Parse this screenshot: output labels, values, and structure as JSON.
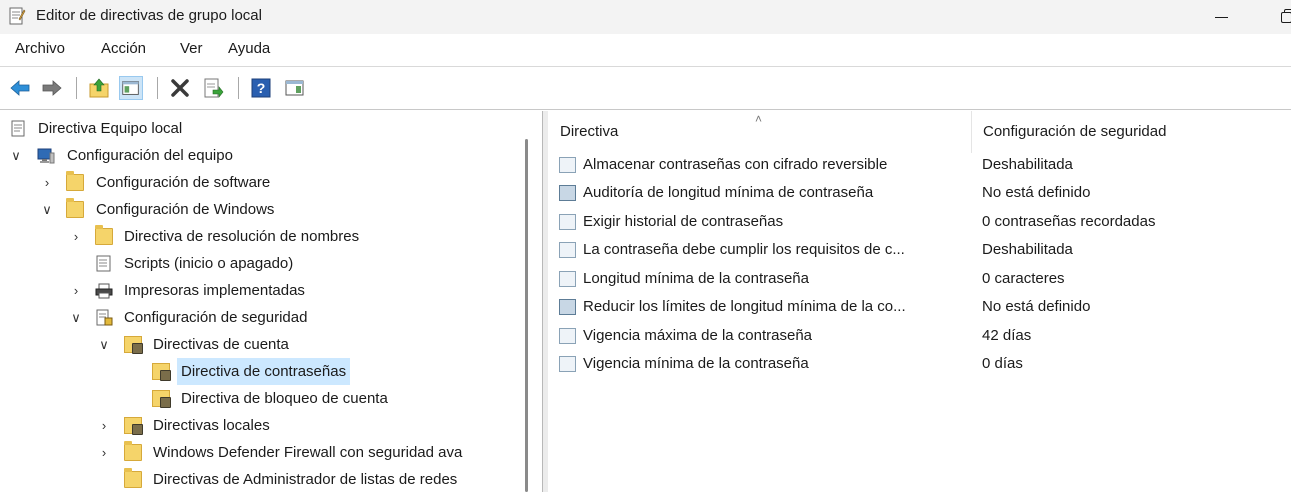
{
  "window": {
    "title": "Editor de directivas de grupo local"
  },
  "menu": [
    "Archivo",
    "Acción",
    "Ver",
    "Ayuda"
  ],
  "toolbar": {
    "buttons": [
      "back-arrow-icon",
      "forward-arrow-icon",
      "up-folder-icon",
      "show-hide-tree-icon",
      "delete-icon",
      "export-list-icon",
      "help-icon",
      "properties-view-icon"
    ]
  },
  "tree": {
    "root": "Directiva Equipo local",
    "computer_config": "Configuración del equipo",
    "software_config": "Configuración de software",
    "windows_config": "Configuración de Windows",
    "name_resolution": "Directiva de resolución de nombres",
    "scripts": "Scripts (inicio o apagado)",
    "printers": "Impresoras implementadas",
    "security_config": "Configuración de seguridad",
    "account_policies": "Directivas de cuenta",
    "password_policy": "Directiva de contraseñas",
    "lockout_policy": "Directiva de bloqueo de cuenta",
    "local_policies": "Directivas locales",
    "firewall": "Windows Defender Firewall con seguridad ava",
    "network_list": "Directivas de Administrador de listas de redes"
  },
  "list": {
    "columns": [
      "Directiva",
      "Configuración de seguridad"
    ],
    "rows": [
      {
        "name": "Almacenar contraseñas con cifrado reversible",
        "value": "Deshabilitada"
      },
      {
        "name": "Auditoría de longitud mínima de contraseña",
        "value": "No está definido"
      },
      {
        "name": "Exigir historial de contraseñas",
        "value": "0 contraseñas recordadas"
      },
      {
        "name": "La contraseña debe cumplir los requisitos de c...",
        "value": "Deshabilitada"
      },
      {
        "name": "Longitud mínima de la contraseña",
        "value": "0 caracteres"
      },
      {
        "name": "Reducir los límites de longitud mínima de la co...",
        "value": "No está definido"
      },
      {
        "name": "Vigencia máxima de la contraseña",
        "value": "42 días"
      },
      {
        "name": "Vigencia mínima de la contraseña",
        "value": "0 días"
      }
    ]
  },
  "colors": {
    "selection": "#cce8ff",
    "titlebar": "#f3f3f3",
    "folder": "#f5d46a"
  }
}
